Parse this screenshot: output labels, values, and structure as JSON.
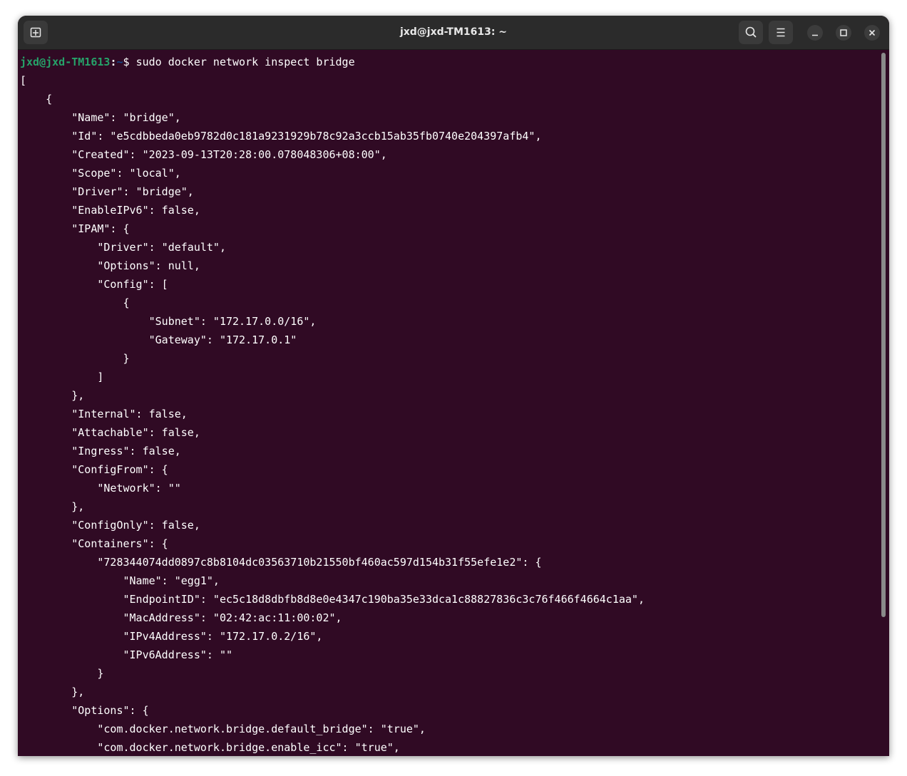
{
  "window": {
    "title": "jxd@jxd-TM1613: ~"
  },
  "titlebar": {
    "icons": [
      "new-tab-icon",
      "search-icon",
      "hamburger-menu-icon",
      "minimize-icon",
      "maximize-icon",
      "close-icon"
    ]
  },
  "prompt": {
    "user_host": "jxd@jxd-TM1613",
    "sep": ":",
    "path": "~",
    "symbol": "$ ",
    "command": "sudo docker network inspect bridge"
  },
  "output": [
    "[",
    "    {",
    "        \"Name\": \"bridge\",",
    "        \"Id\": \"e5cdbbeda0eb9782d0c181a9231929b78c92a3ccb15ab35fb0740e204397afb4\",",
    "        \"Created\": \"2023-09-13T20:28:00.078048306+08:00\",",
    "        \"Scope\": \"local\",",
    "        \"Driver\": \"bridge\",",
    "        \"EnableIPv6\": false,",
    "        \"IPAM\": {",
    "            \"Driver\": \"default\",",
    "            \"Options\": null,",
    "            \"Config\": [",
    "                {",
    "                    \"Subnet\": \"172.17.0.0/16\",",
    "                    \"Gateway\": \"172.17.0.1\"",
    "                }",
    "            ]",
    "        },",
    "        \"Internal\": false,",
    "        \"Attachable\": false,",
    "        \"Ingress\": false,",
    "        \"ConfigFrom\": {",
    "            \"Network\": \"\"",
    "        },",
    "        \"ConfigOnly\": false,",
    "        \"Containers\": {",
    "            \"728344074dd0897c8b8104dc03563710b21550bf460ac597d154b31f55efe1e2\": {",
    "                \"Name\": \"egg1\",",
    "                \"EndpointID\": \"ec5c18d8dbfb8d8e0e4347c190ba35e33dca1c88827836c3c76f466f4664c1aa\",",
    "                \"MacAddress\": \"02:42:ac:11:00:02\",",
    "                \"IPv4Address\": \"172.17.0.2/16\",",
    "                \"IPv6Address\": \"\"",
    "            }",
    "        },",
    "        \"Options\": {",
    "            \"com.docker.network.bridge.default_bridge\": \"true\",",
    "            \"com.docker.network.bridge.enable_icc\": \"true\","
  ],
  "colors": {
    "terminal_bg": "#300a24",
    "titlebar_bg": "#2b2b2b",
    "prompt_user": "#26a269",
    "prompt_path": "#12488b",
    "text": "#ffffff"
  }
}
